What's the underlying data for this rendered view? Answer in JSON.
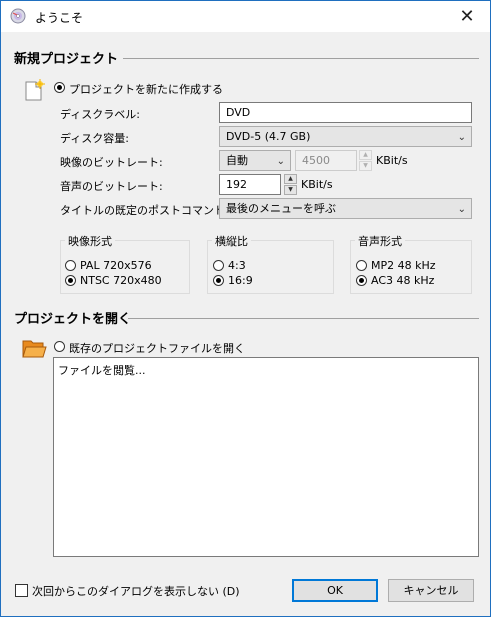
{
  "window": {
    "title": "ようこそ",
    "close_glyph": "✕"
  },
  "new_project": {
    "heading": "新規プロジェクト",
    "create_radio_label": "プロジェクトを新たに作成する",
    "disc_label": {
      "label": "ディスクラベル:",
      "value": "DVD"
    },
    "disc_capacity": {
      "label": "ディスク容量:",
      "selected": "DVD-5 (4.7 GB)"
    },
    "video_bitrate": {
      "label": "映像のビットレート:",
      "mode": "自動",
      "value": "4500",
      "unit": "KBit/s"
    },
    "audio_bitrate": {
      "label": "音声のビットレート:",
      "value": "192",
      "unit": "KBit/s"
    },
    "post_command": {
      "label": "タイトルの既定のポストコマンド:",
      "selected": "最後のメニューを呼ぶ"
    },
    "video_format": {
      "title": "映像形式",
      "options": [
        "PAL 720x576",
        "NTSC 720x480"
      ],
      "selected_index": 1
    },
    "aspect_ratio": {
      "title": "横縦比",
      "options": [
        "4:3",
        "16:9"
      ],
      "selected_index": 1
    },
    "audio_format": {
      "title": "音声形式",
      "options": [
        "MP2 48 kHz",
        "AC3 48 kHz"
      ],
      "selected_index": 1
    }
  },
  "open_project": {
    "heading": "プロジェクトを開く",
    "open_radio_label": "既存のプロジェクトファイルを開く",
    "file_list": [
      "ファイルを閲覧..."
    ]
  },
  "footer": {
    "dont_show_label": "次回からこのダイアログを表示しない (D)",
    "ok_label": "OK",
    "cancel_label": "キャンセル"
  },
  "colors": {
    "accent": "#0078d7",
    "frame": "#1f6fbf"
  },
  "icons": {
    "app": "disc-icon",
    "new": "new-document-icon",
    "open": "open-folder-icon"
  }
}
